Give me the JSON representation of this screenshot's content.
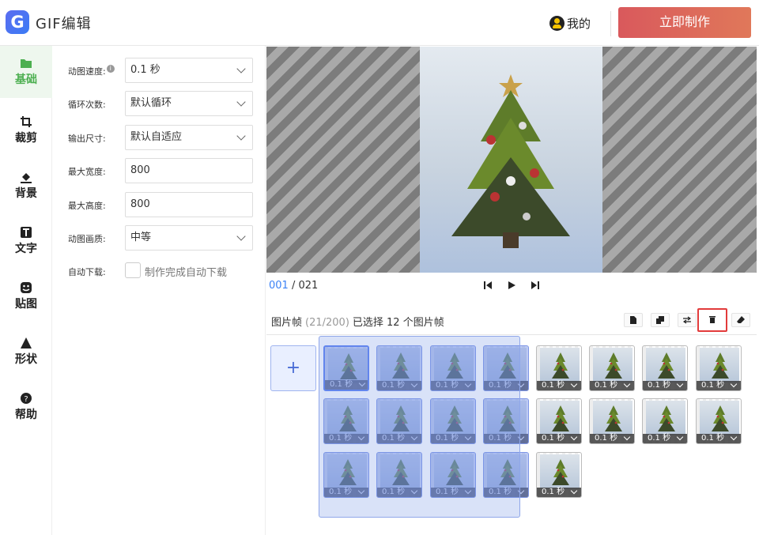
{
  "header": {
    "logo_letter": "G",
    "app_title": "GIF编辑",
    "user_label": "我的",
    "make_button": "立即制作"
  },
  "nav": [
    {
      "label": "基础",
      "icon": "folder-icon",
      "active": true
    },
    {
      "label": "裁剪",
      "icon": "crop-icon"
    },
    {
      "label": "背景",
      "icon": "paint-bucket-icon"
    },
    {
      "label": "文字",
      "icon": "text-icon"
    },
    {
      "label": "贴图",
      "icon": "sticker-icon"
    },
    {
      "label": "形状",
      "icon": "triangle-icon"
    },
    {
      "label": "帮助",
      "icon": "help-icon"
    }
  ],
  "settings": {
    "speed_label": "动图速度:",
    "speed_value": "0.1 秒",
    "loop_label": "循环次数:",
    "loop_value": "默认循环",
    "size_label": "输出尺寸:",
    "size_value": "默认自适应",
    "max_width_label": "最大宽度:",
    "max_width_value": "800",
    "max_height_label": "最大高度:",
    "max_height_value": "800",
    "quality_label": "动图画质:",
    "quality_value": "中等",
    "auto_download_label": "自动下载:",
    "auto_download_text": "制作完成自动下载"
  },
  "playback": {
    "current": "001",
    "separator": " / ",
    "total": "021"
  },
  "frames": {
    "title": "图片帧",
    "count": "(21/200)",
    "selected_text": "已选择 12 个图片帧",
    "add_label": "+",
    "duration": "0.1 秒",
    "total_frames": 21,
    "selected_frames": 12
  },
  "colors": {
    "accent": "#4caf50",
    "make_button": "#d9595c",
    "selection": "#7e96e6",
    "highlight": "#e23b3b"
  }
}
